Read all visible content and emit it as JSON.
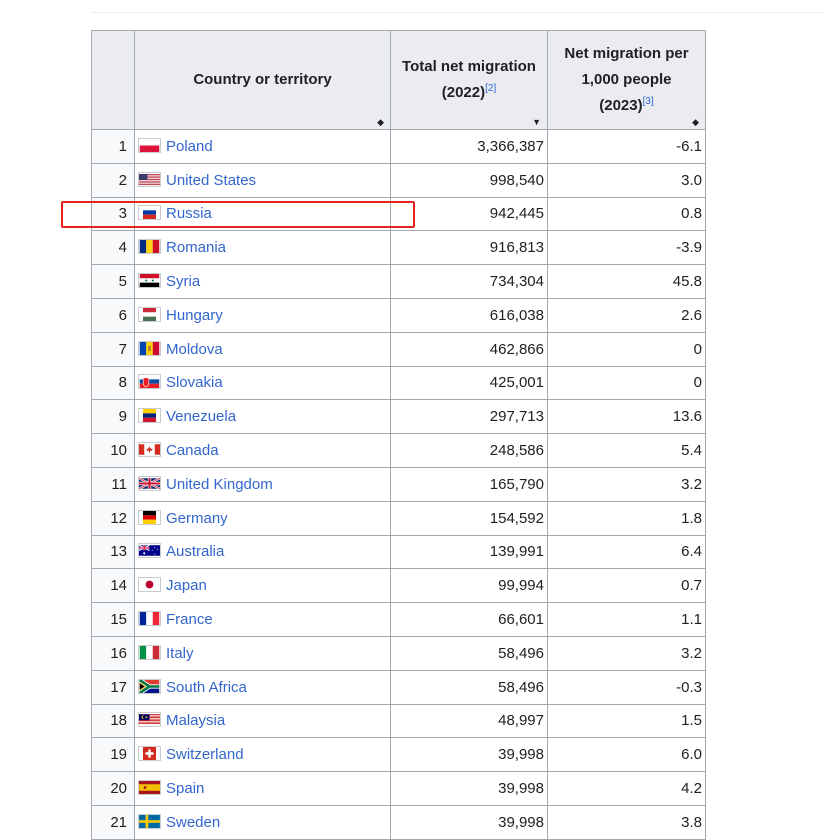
{
  "table": {
    "headers": {
      "country": "Country or territory",
      "total_net": "Total net migration (2022)",
      "total_ref": "[2]",
      "per_1000_line1": "Net migration per",
      "per_1000_line2": "1,000 people",
      "per_1000_line3": "(2023)",
      "per_ref": "[3]"
    },
    "sort_icons": {
      "both": "◆",
      "descending": "▼"
    },
    "rows": [
      {
        "rank": "1",
        "country": "Poland",
        "total": "3,366,387",
        "per_1000": "-6.1",
        "flag_icon": "poland-flag-icon"
      },
      {
        "rank": "2",
        "country": "United States",
        "total": "998,540",
        "per_1000": "3.0",
        "flag_icon": "united-states-flag-icon"
      },
      {
        "rank": "3",
        "country": "Russia",
        "total": "942,445",
        "per_1000": "0.8",
        "flag_icon": "russia-flag-icon"
      },
      {
        "rank": "4",
        "country": "Romania",
        "total": "916,813",
        "per_1000": "-3.9",
        "flag_icon": "romania-flag-icon"
      },
      {
        "rank": "5",
        "country": "Syria",
        "total": "734,304",
        "per_1000": "45.8",
        "flag_icon": "syria-flag-icon"
      },
      {
        "rank": "6",
        "country": "Hungary",
        "total": "616,038",
        "per_1000": "2.6",
        "flag_icon": "hungary-flag-icon"
      },
      {
        "rank": "7",
        "country": "Moldova",
        "total": "462,866",
        "per_1000": "0",
        "flag_icon": "moldova-flag-icon"
      },
      {
        "rank": "8",
        "country": "Slovakia",
        "total": "425,001",
        "per_1000": "0",
        "flag_icon": "slovakia-flag-icon"
      },
      {
        "rank": "9",
        "country": "Venezuela",
        "total": "297,713",
        "per_1000": "13.6",
        "flag_icon": "venezuela-flag-icon"
      },
      {
        "rank": "10",
        "country": "Canada",
        "total": "248,586",
        "per_1000": "5.4",
        "flag_icon": "canada-flag-icon"
      },
      {
        "rank": "11",
        "country": "United Kingdom",
        "total": "165,790",
        "per_1000": "3.2",
        "flag_icon": "united-kingdom-flag-icon"
      },
      {
        "rank": "12",
        "country": "Germany",
        "total": "154,592",
        "per_1000": "1.8",
        "flag_icon": "germany-flag-icon"
      },
      {
        "rank": "13",
        "country": "Australia",
        "total": "139,991",
        "per_1000": "6.4",
        "flag_icon": "australia-flag-icon"
      },
      {
        "rank": "14",
        "country": "Japan",
        "total": "99,994",
        "per_1000": "0.7",
        "flag_icon": "japan-flag-icon"
      },
      {
        "rank": "15",
        "country": "France",
        "total": "66,601",
        "per_1000": "1.1",
        "flag_icon": "france-flag-icon"
      },
      {
        "rank": "16",
        "country": "Italy",
        "total": "58,496",
        "per_1000": "3.2",
        "flag_icon": "italy-flag-icon"
      },
      {
        "rank": "17",
        "country": "South Africa",
        "total": "58,496",
        "per_1000": "-0.3",
        "flag_icon": "south-africa-flag-icon"
      },
      {
        "rank": "18",
        "country": "Malaysia",
        "total": "48,997",
        "per_1000": "1.5",
        "flag_icon": "malaysia-flag-icon"
      },
      {
        "rank": "19",
        "country": "Switzerland",
        "total": "39,998",
        "per_1000": "6.0",
        "flag_icon": "switzerland-flag-icon"
      },
      {
        "rank": "20",
        "country": "Spain",
        "total": "39,998",
        "per_1000": "4.2",
        "flag_icon": "spain-flag-icon"
      },
      {
        "rank": "21",
        "country": "Sweden",
        "total": "39,998",
        "per_1000": "3.8",
        "flag_icon": "sweden-flag-icon"
      }
    ]
  },
  "colors": {
    "link": "#3366cc",
    "header_bg": "#eaecf0",
    "border": "#a2a9b1",
    "highlight_box": "#e3261c"
  },
  "highlight": {
    "row_rank": "3",
    "country": "Russia"
  }
}
